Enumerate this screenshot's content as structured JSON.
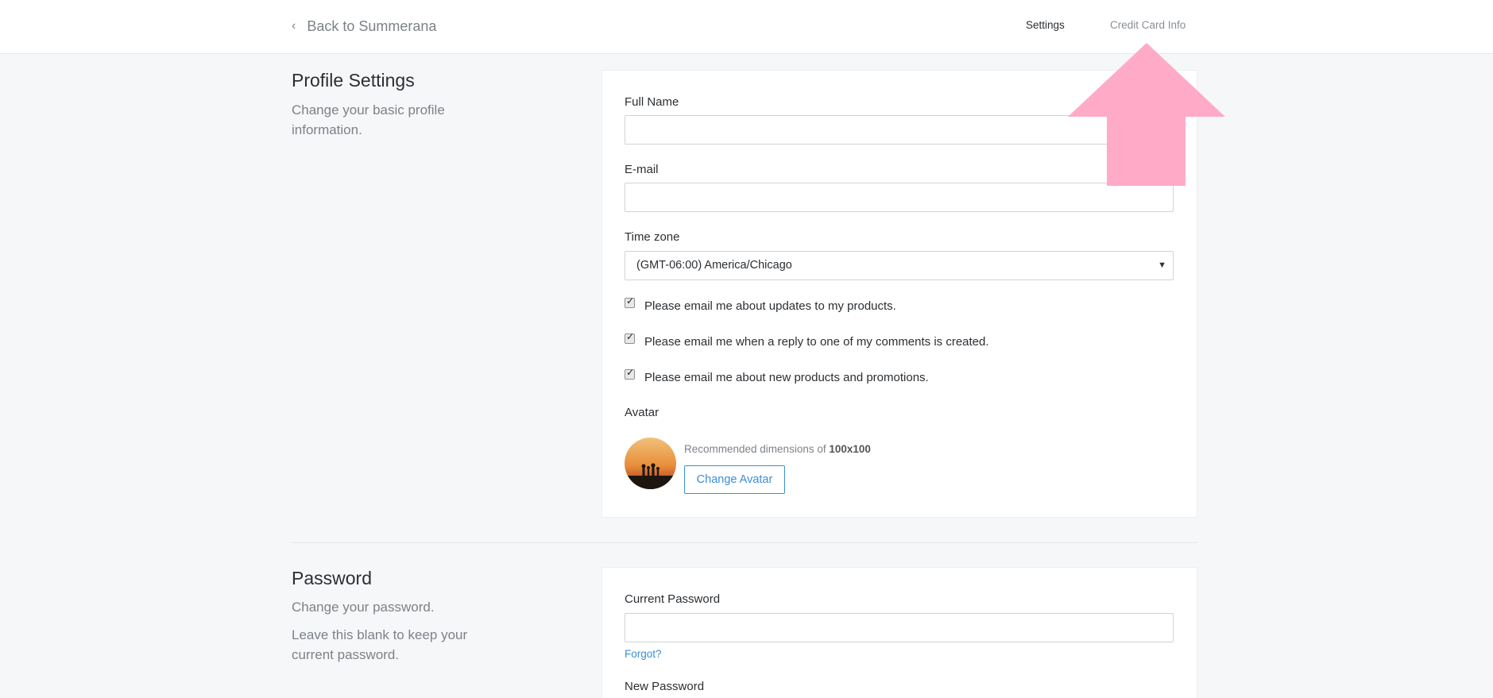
{
  "header": {
    "back_label": "Back to Summerana",
    "nav": {
      "settings": "Settings",
      "credit_card": "Credit Card Info"
    }
  },
  "profile": {
    "title": "Profile Settings",
    "description": "Change your basic profile information.",
    "full_name_label": "Full Name",
    "full_name_value": "",
    "email_label": "E-mail",
    "email_value": "",
    "timezone_label": "Time zone",
    "timezone_value": "(GMT-06:00) America/Chicago",
    "checkboxes": [
      {
        "label": "Please email me about updates to my products.",
        "checked": true
      },
      {
        "label": "Please email me when a reply to one of my comments is created.",
        "checked": true
      },
      {
        "label": "Please email me about new products and promotions.",
        "checked": true
      }
    ],
    "avatar_label": "Avatar",
    "avatar_hint_prefix": "Recommended dimensions of ",
    "avatar_hint_dims": "100x100",
    "change_avatar_label": "Change Avatar"
  },
  "password": {
    "title": "Password",
    "description_1": "Change your password.",
    "description_2": "Leave this blank to keep your current password.",
    "current_label": "Current Password",
    "forgot_label": "Forgot?",
    "new_label": "New Password"
  },
  "colors": {
    "accent": "#3a8fd9",
    "arrow": "#ffabc8",
    "background": "#f6f7f9"
  }
}
